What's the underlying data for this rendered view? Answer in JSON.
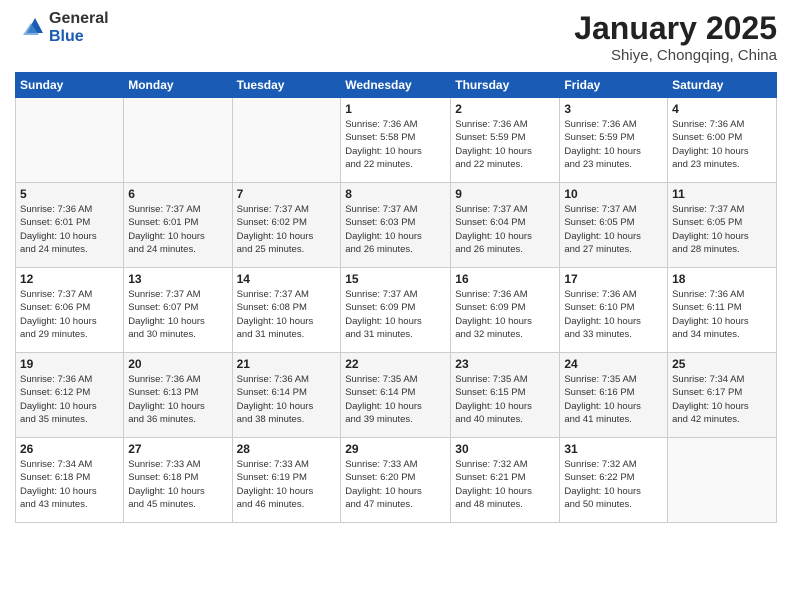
{
  "logo": {
    "general": "General",
    "blue": "Blue"
  },
  "title": "January 2025",
  "subtitle": "Shiye, Chongqing, China",
  "weekdays": [
    "Sunday",
    "Monday",
    "Tuesday",
    "Wednesday",
    "Thursday",
    "Friday",
    "Saturday"
  ],
  "weeks": [
    [
      {
        "day": "",
        "info": ""
      },
      {
        "day": "",
        "info": ""
      },
      {
        "day": "",
        "info": ""
      },
      {
        "day": "1",
        "info": "Sunrise: 7:36 AM\nSunset: 5:58 PM\nDaylight: 10 hours\nand 22 minutes."
      },
      {
        "day": "2",
        "info": "Sunrise: 7:36 AM\nSunset: 5:59 PM\nDaylight: 10 hours\nand 22 minutes."
      },
      {
        "day": "3",
        "info": "Sunrise: 7:36 AM\nSunset: 5:59 PM\nDaylight: 10 hours\nand 23 minutes."
      },
      {
        "day": "4",
        "info": "Sunrise: 7:36 AM\nSunset: 6:00 PM\nDaylight: 10 hours\nand 23 minutes."
      }
    ],
    [
      {
        "day": "5",
        "info": "Sunrise: 7:36 AM\nSunset: 6:01 PM\nDaylight: 10 hours\nand 24 minutes."
      },
      {
        "day": "6",
        "info": "Sunrise: 7:37 AM\nSunset: 6:01 PM\nDaylight: 10 hours\nand 24 minutes."
      },
      {
        "day": "7",
        "info": "Sunrise: 7:37 AM\nSunset: 6:02 PM\nDaylight: 10 hours\nand 25 minutes."
      },
      {
        "day": "8",
        "info": "Sunrise: 7:37 AM\nSunset: 6:03 PM\nDaylight: 10 hours\nand 26 minutes."
      },
      {
        "day": "9",
        "info": "Sunrise: 7:37 AM\nSunset: 6:04 PM\nDaylight: 10 hours\nand 26 minutes."
      },
      {
        "day": "10",
        "info": "Sunrise: 7:37 AM\nSunset: 6:05 PM\nDaylight: 10 hours\nand 27 minutes."
      },
      {
        "day": "11",
        "info": "Sunrise: 7:37 AM\nSunset: 6:05 PM\nDaylight: 10 hours\nand 28 minutes."
      }
    ],
    [
      {
        "day": "12",
        "info": "Sunrise: 7:37 AM\nSunset: 6:06 PM\nDaylight: 10 hours\nand 29 minutes."
      },
      {
        "day": "13",
        "info": "Sunrise: 7:37 AM\nSunset: 6:07 PM\nDaylight: 10 hours\nand 30 minutes."
      },
      {
        "day": "14",
        "info": "Sunrise: 7:37 AM\nSunset: 6:08 PM\nDaylight: 10 hours\nand 31 minutes."
      },
      {
        "day": "15",
        "info": "Sunrise: 7:37 AM\nSunset: 6:09 PM\nDaylight: 10 hours\nand 31 minutes."
      },
      {
        "day": "16",
        "info": "Sunrise: 7:36 AM\nSunset: 6:09 PM\nDaylight: 10 hours\nand 32 minutes."
      },
      {
        "day": "17",
        "info": "Sunrise: 7:36 AM\nSunset: 6:10 PM\nDaylight: 10 hours\nand 33 minutes."
      },
      {
        "day": "18",
        "info": "Sunrise: 7:36 AM\nSunset: 6:11 PM\nDaylight: 10 hours\nand 34 minutes."
      }
    ],
    [
      {
        "day": "19",
        "info": "Sunrise: 7:36 AM\nSunset: 6:12 PM\nDaylight: 10 hours\nand 35 minutes."
      },
      {
        "day": "20",
        "info": "Sunrise: 7:36 AM\nSunset: 6:13 PM\nDaylight: 10 hours\nand 36 minutes."
      },
      {
        "day": "21",
        "info": "Sunrise: 7:36 AM\nSunset: 6:14 PM\nDaylight: 10 hours\nand 38 minutes."
      },
      {
        "day": "22",
        "info": "Sunrise: 7:35 AM\nSunset: 6:14 PM\nDaylight: 10 hours\nand 39 minutes."
      },
      {
        "day": "23",
        "info": "Sunrise: 7:35 AM\nSunset: 6:15 PM\nDaylight: 10 hours\nand 40 minutes."
      },
      {
        "day": "24",
        "info": "Sunrise: 7:35 AM\nSunset: 6:16 PM\nDaylight: 10 hours\nand 41 minutes."
      },
      {
        "day": "25",
        "info": "Sunrise: 7:34 AM\nSunset: 6:17 PM\nDaylight: 10 hours\nand 42 minutes."
      }
    ],
    [
      {
        "day": "26",
        "info": "Sunrise: 7:34 AM\nSunset: 6:18 PM\nDaylight: 10 hours\nand 43 minutes."
      },
      {
        "day": "27",
        "info": "Sunrise: 7:33 AM\nSunset: 6:18 PM\nDaylight: 10 hours\nand 45 minutes."
      },
      {
        "day": "28",
        "info": "Sunrise: 7:33 AM\nSunset: 6:19 PM\nDaylight: 10 hours\nand 46 minutes."
      },
      {
        "day": "29",
        "info": "Sunrise: 7:33 AM\nSunset: 6:20 PM\nDaylight: 10 hours\nand 47 minutes."
      },
      {
        "day": "30",
        "info": "Sunrise: 7:32 AM\nSunset: 6:21 PM\nDaylight: 10 hours\nand 48 minutes."
      },
      {
        "day": "31",
        "info": "Sunrise: 7:32 AM\nSunset: 6:22 PM\nDaylight: 10 hours\nand 50 minutes."
      },
      {
        "day": "",
        "info": ""
      }
    ]
  ]
}
